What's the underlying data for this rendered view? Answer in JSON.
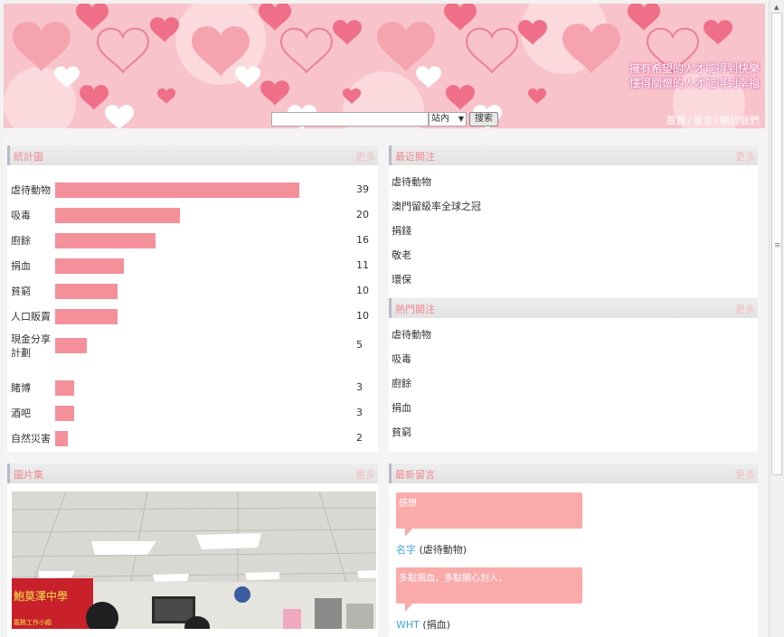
{
  "header": {
    "slogan_line1": "擁有希望的人才能得到快樂",
    "slogan_line2": "懂得關懷的人才能得到幸福",
    "search_placeholder": "",
    "search_scope": "站內",
    "search_button": "搜索",
    "nav": [
      "首頁",
      "/",
      "留言",
      "/",
      "關於我們"
    ]
  },
  "stats": {
    "title": "統計圖",
    "more": "更多",
    "rows": [
      {
        "label": "虐待動物",
        "value": 39
      },
      {
        "label": "吸毒",
        "value": 20
      },
      {
        "label": "廚餘",
        "value": 16
      },
      {
        "label": "捐血",
        "value": 11
      },
      {
        "label": "貧窮",
        "value": 10
      },
      {
        "label": "人口販賣",
        "value": 10
      },
      {
        "label": "現金分享計劃",
        "value": 5
      },
      {
        "label": "賭博",
        "value": 3
      },
      {
        "label": "酒吧",
        "value": 3
      },
      {
        "label": "自然災害",
        "value": 2
      }
    ]
  },
  "chart_data": {
    "type": "bar",
    "title": "統計圖",
    "categories": [
      "虐待動物",
      "吸毒",
      "廚餘",
      "捐血",
      "貧窮",
      "人口販賣",
      "現金分享計劃",
      "賭博",
      "酒吧",
      "自然災害"
    ],
    "values": [
      39,
      20,
      16,
      11,
      10,
      10,
      5,
      3,
      3,
      2
    ],
    "orientation": "horizontal",
    "xlim": [
      0,
      39
    ]
  },
  "recent": {
    "title": "最近關注",
    "more": "更多",
    "items": [
      "虐待動物",
      "澳門留級率全球之冠",
      "捐錢",
      "敬老",
      "環保"
    ]
  },
  "hot": {
    "title": "熱門關注",
    "more": "更多",
    "items": [
      "虐待動物",
      "吸毒",
      "廚餘",
      "捐血",
      "貧窮"
    ]
  },
  "gallery": {
    "title": "圖片集",
    "more": "更多",
    "sign_text": "鮑莫澤中學",
    "sign_sub": "義務工作小組"
  },
  "messages": {
    "title": "最新留言",
    "more": "更多",
    "items": [
      {
        "text": "感想",
        "author": "名字",
        "topic": "(虐待動物)"
      },
      {
        "text": "多點捐血，多點關心別人，",
        "author": "WHT",
        "topic": "(捐血)"
      }
    ]
  },
  "colors": {
    "bar": "#f4909a",
    "title": "#ee8a92",
    "bubble": "#f9aaa9",
    "author": "#3fa6d8"
  }
}
